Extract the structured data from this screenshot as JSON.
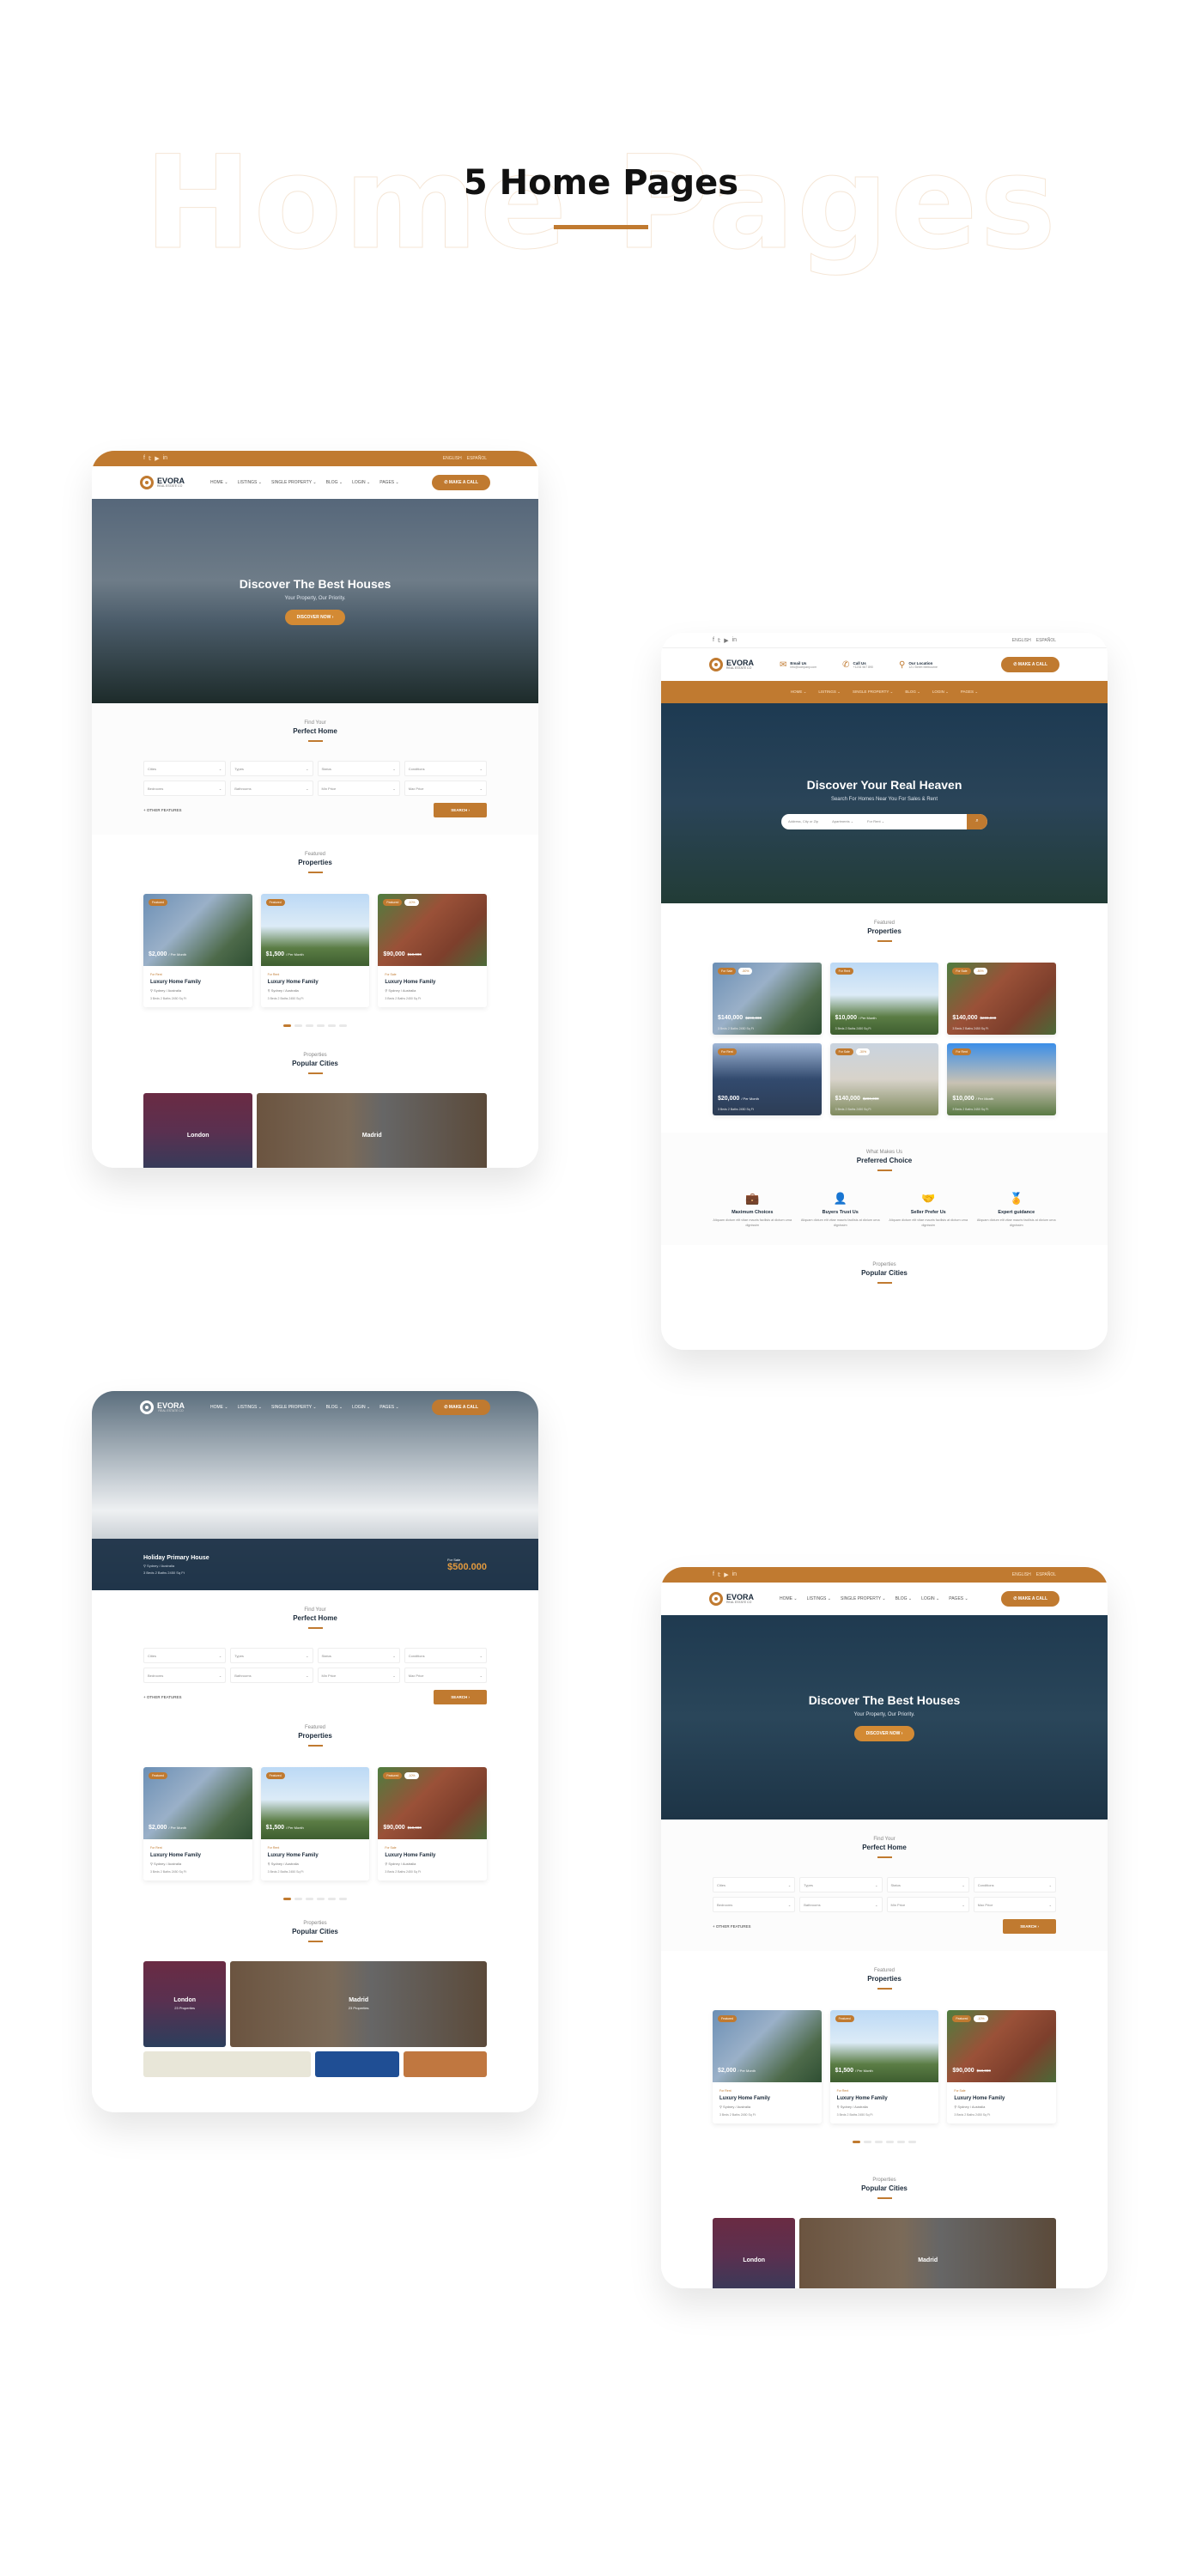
{
  "page": {
    "ghost_title": "Home Pages",
    "title": "5 Home Pages",
    "accent": "#c07a30"
  },
  "common": {
    "social": [
      "f",
      "t",
      "yt",
      "in"
    ],
    "lang": [
      "ENGLISH",
      "ESPAÑOL"
    ],
    "brand": "EVORA",
    "brand_sub": "REAL ESTATE CO",
    "nav": [
      "HOME ⌄",
      "LISTINGS ⌄",
      "SINGLE PROPERTY ⌄",
      "BLOG ⌄",
      "LOGIN ⌄",
      "PAGES ⌄"
    ],
    "call": "✆ MAKE A CALL",
    "discover_btn": "DISCOVER NOW ›",
    "find_pre": "Find Your",
    "find_title": "Perfect Home",
    "filters": [
      "Cities",
      "Types",
      "Status",
      "Conditions",
      "Bedrooms",
      "Bathrooms",
      "Min Price",
      "Max Price"
    ],
    "other_features": "+ OTHER FEATURES",
    "search": "SEARCH ›",
    "feat_pre": "Featured",
    "feat_title": "Properties",
    "cities_pre": "Properties",
    "cities_title": "Popular Cities",
    "cards": [
      {
        "badge": "Featured",
        "badge2": "",
        "price": "$2,000",
        "suffix": "/ Per Month",
        "old": "",
        "status": "For Rent",
        "title": "Luxury Home Family",
        "loc": "Sydney / Australia",
        "meta": "3 Beds  2 Baths  2450 Sq Ft"
      },
      {
        "badge": "Featured",
        "badge2": "",
        "price": "$1,500",
        "suffix": "/ Per Month",
        "old": "",
        "status": "For Rent",
        "title": "Luxury Home Family",
        "loc": "Sydney / Australia",
        "meta": "3 Beds  2 Baths  2450 Sq Ft"
      },
      {
        "badge": "Featured",
        "badge2": "-10%",
        "price": "$90,000",
        "suffix": "",
        "old": "$10,000",
        "status": "For Sale",
        "title": "Luxury Home Family",
        "loc": "Sydney / Australia",
        "meta": "3 Beds  2 Baths  2450 Sq Ft"
      }
    ],
    "cities": [
      {
        "name": "London",
        "count": "23 Properties"
      },
      {
        "name": "Madrid",
        "count": "23 Properties"
      }
    ]
  },
  "mock1": {
    "hero_title": "Discover The Best Houses",
    "hero_sub": "Your Property, Our Priority."
  },
  "mock2": {
    "contacts": [
      {
        "icon": "chat-icon",
        "glyph": "💬",
        "title": "Email Us",
        "sub": "info@company.com"
      },
      {
        "icon": "phone-icon",
        "glyph": "✆",
        "title": "Call Us",
        "sub": "+1234 567 890"
      },
      {
        "icon": "location-icon",
        "glyph": "⚲",
        "title": "Our Location",
        "sub": "121 Street Melbourne"
      }
    ],
    "hero_title": "Discover Your Real Heaven",
    "hero_sub": "Search For Homes Near You For Sales & Rent",
    "search_placeholder": "Address, City or Zip",
    "type": "Apartments ⌄",
    "mode": "For Rent ⌄",
    "grid": [
      {
        "badge": "For Sale",
        "badge2": "-50%",
        "price": "$140,000",
        "suffix": "",
        "old": "$200,000",
        "meta": "3 Beds  2 Baths  2450 Sq Ft"
      },
      {
        "badge": "For Rent",
        "badge2": "",
        "price": "$10,000",
        "suffix": "/ Per Month",
        "old": "",
        "meta": "3 Beds  2 Baths  2450 Sq Ft"
      },
      {
        "badge": "For Sale",
        "badge2": "-50%",
        "price": "$140,000",
        "suffix": "",
        "old": "$200,000",
        "meta": "3 Beds  2 Baths  2450 Sq Ft"
      },
      {
        "badge": "For Rent",
        "badge2": "",
        "price": "$20,000",
        "suffix": "/ Per Month",
        "old": "",
        "meta": "3 Beds  2 Baths  2450 Sq Ft"
      },
      {
        "badge": "For Sale",
        "badge2": "-30%",
        "price": "$140,000",
        "suffix": "",
        "old": "$200,000",
        "meta": "3 Beds  2 Baths  2450 Sq Ft"
      },
      {
        "badge": "For Rent",
        "badge2": "",
        "price": "$10,000",
        "suffix": "/ Per Month",
        "old": "",
        "meta": "3 Beds  2 Baths  2450 Sq Ft"
      }
    ],
    "pref_pre": "What Makes Us",
    "pref_title": "Preferred Choice",
    "pref": [
      {
        "icon": "briefcase-icon",
        "glyph": "💼",
        "title": "Maximum Choices",
        "text": "Aliquam dictum elit vitae mauris facilisis at dictum urna dignissim"
      },
      {
        "icon": "user-shield-icon",
        "glyph": "👤",
        "title": "Buyers Trust Us",
        "text": "Aliquam dictum elit vitae mauris facilisis at dictum urna dignissim"
      },
      {
        "icon": "handshake-icon",
        "glyph": "🤝",
        "title": "Seller Prefer Us",
        "text": "Aliquam dictum elit vitae mauris facilisis at dictum urna dignissim"
      },
      {
        "icon": "medal-icon",
        "glyph": "🏅",
        "title": "Expert guidance",
        "text": "Aliquam dictum elit vitae mauris facilisis at dictum urna dignissim"
      }
    ]
  },
  "mock3": {
    "title": "Holiday Primary House",
    "loc": "Sydney / Australia",
    "meta": "3 Beds   2 Baths   2450 Sq Ft",
    "status": "For Sale",
    "price": "$500.000"
  },
  "mock4": {
    "hero_title": "Discover The Best Houses",
    "hero_sub": "Your Property, Our Priority."
  }
}
